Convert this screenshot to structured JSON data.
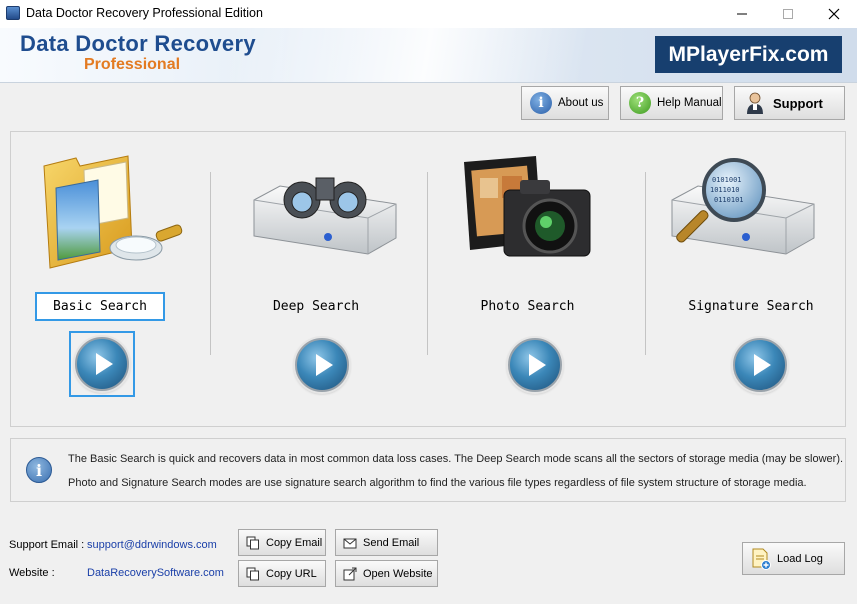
{
  "window": {
    "title": "Data Doctor Recovery Professional Edition",
    "controls": [
      "minimize",
      "maximize",
      "close"
    ]
  },
  "banner": {
    "product_name": "Data Doctor Recovery",
    "edition": "Professional",
    "watermark": "MPlayerFix.com"
  },
  "toolbar": {
    "about_label": "About us",
    "help_label": "Help Manual",
    "support_label": "Support"
  },
  "modes": [
    {
      "label": "Basic Search",
      "icon": "folder-magnifier-icon",
      "selected": true
    },
    {
      "label": "Deep Search",
      "icon": "drive-binoculars-icon",
      "selected": false
    },
    {
      "label": "Photo Search",
      "icon": "camera-film-icon",
      "selected": false
    },
    {
      "label": "Signature Search",
      "icon": "drive-magnifier-icon",
      "selected": false
    }
  ],
  "info": {
    "line1": "The Basic Search is quick and recovers data in most common data loss cases. The Deep Search mode scans all the sectors of storage media (may be slower).",
    "line2": "Photo and Signature Search modes are use signature search algorithm to find the various file types regardless of file system structure of storage media."
  },
  "footer": {
    "support_email_label": "Support Email :",
    "support_email": "support@ddrwindows.com",
    "website_label": "Website :",
    "website": "DataRecoverySoftware.com",
    "copy_email_label": "Copy Email",
    "send_email_label": "Send Email",
    "copy_url_label": "Copy URL",
    "open_website_label": "Open Website",
    "load_log_label": "Load Log"
  },
  "colors": {
    "brand_blue": "#1f4d8f",
    "brand_orange": "#e37b22",
    "selection_blue": "#3399e6",
    "link_blue": "#1a3fa8"
  }
}
